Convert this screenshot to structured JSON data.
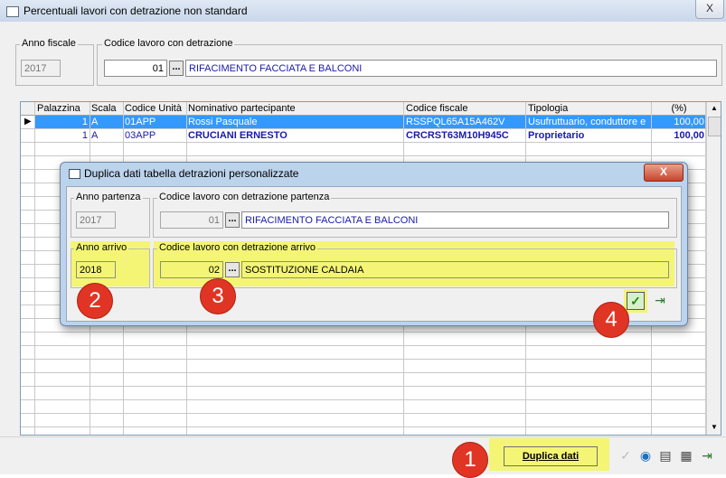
{
  "window": {
    "title": "Percentuali lavori con detrazione non standard",
    "close": "X"
  },
  "header": {
    "anno_fiscale_label": "Anno fiscale",
    "anno_fiscale_value": "2017",
    "codice_label": "Codice lavoro con detrazione",
    "codice_num": "01",
    "codice_desc": "RIFACIMENTO FACCIATA E BALCONI"
  },
  "grid": {
    "columns": [
      "Palazzina",
      "Scala",
      "Codice Unità",
      "Nominativo partecipante",
      "Codice fiscale",
      "Tipologia",
      "(%)"
    ],
    "rows": [
      {
        "palazzina": "1",
        "scala": "A",
        "codice_unita": "01APP",
        "nominativo": "Rossi Pasquale",
        "codice_fiscale": "RSSPQL65A15A462V",
        "tipologia": "Usufruttuario, conduttore e",
        "perc": "100,00"
      },
      {
        "palazzina": "1",
        "scala": "A",
        "codice_unita": "03APP",
        "nominativo": "CRUCIANI ERNESTO",
        "codice_fiscale": "CRCRST63M10H945C",
        "tipologia": "Proprietario",
        "perc": "100,00"
      }
    ]
  },
  "dialog": {
    "title": "Duplica dati tabella detrazioni personalizzate",
    "close": "X",
    "anno_partenza_label": "Anno partenza",
    "anno_partenza_value": "2017",
    "codice_partenza_label": "Codice lavoro con detrazione partenza",
    "codice_partenza_num": "01",
    "codice_partenza_desc": "RIFACIMENTO FACCIATA E BALCONI",
    "anno_arrivo_label": "Anno arrivo",
    "anno_arrivo_value": "2018",
    "codice_arrivo_label": "Codice lavoro con detrazione arrivo",
    "codice_arrivo_num": "02",
    "codice_arrivo_desc": "SOSTITUZIONE CALDAIA"
  },
  "badges": [
    "1",
    "2",
    "3",
    "4"
  ],
  "bottom": {
    "duplica_label": "Duplica dati"
  },
  "colors": {
    "highlight": "#f4f574",
    "selected_row": "#3399ff",
    "badge": "#e03524",
    "accent_blue": "#1a1aa6"
  }
}
